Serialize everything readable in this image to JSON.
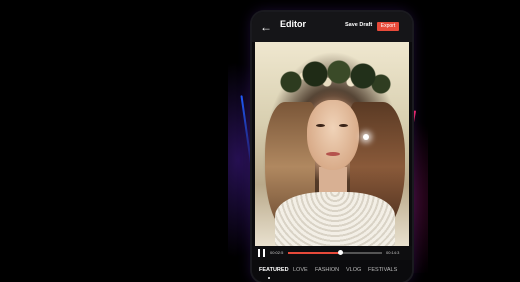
{
  "appbar": {
    "title": "Editor",
    "save_draft_label": "Save Draft",
    "export_label": "Export"
  },
  "player": {
    "current_time": "00:02:5",
    "total_time": "00:14:3",
    "progress": 0.55
  },
  "tabs": [
    "FEATURED",
    "LOVE",
    "FASHION",
    "VLOG",
    "FESTIVALS"
  ],
  "colors": {
    "accent": "#e84a3a",
    "background": "#000000"
  },
  "icons": {
    "back": "arrow-left-icon",
    "pause": "pause-icon"
  }
}
